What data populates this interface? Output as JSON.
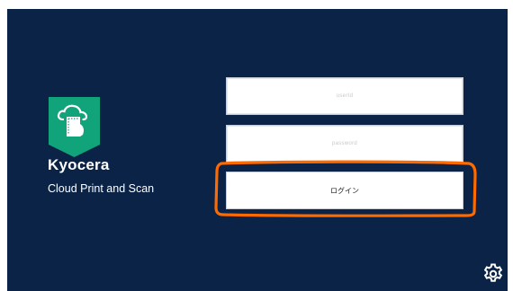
{
  "app": {
    "brand": "Kyocera",
    "product": "Cloud Print and Scan"
  },
  "login_form": {
    "username_placeholder": "userId",
    "password_placeholder": "password",
    "login_label": "ログイン"
  },
  "colors": {
    "background": "#0a2347",
    "logo": "#11a37a",
    "highlight": "#ff6a00"
  },
  "icons": {
    "logo": "cloud-document-icon",
    "settings": "gear-icon"
  }
}
